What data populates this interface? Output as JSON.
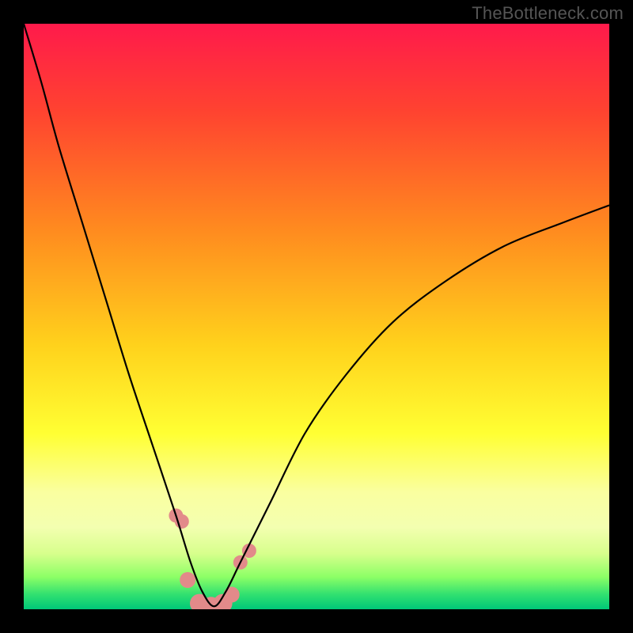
{
  "watermark": "TheBottleneck.com",
  "chart_data": {
    "type": "line",
    "title": "",
    "xlabel": "",
    "ylabel": "",
    "xlim": [
      0,
      100
    ],
    "ylim": [
      0,
      100
    ],
    "grid": false,
    "legend": false,
    "gradient_stops": [
      {
        "offset": 0,
        "color": "#ff1a4b"
      },
      {
        "offset": 0.15,
        "color": "#ff4330"
      },
      {
        "offset": 0.35,
        "color": "#ff8a1f"
      },
      {
        "offset": 0.55,
        "color": "#ffd21c"
      },
      {
        "offset": 0.7,
        "color": "#ffff33"
      },
      {
        "offset": 0.8,
        "color": "#faffa0"
      },
      {
        "offset": 0.86,
        "color": "#f3ffb0"
      },
      {
        "offset": 0.905,
        "color": "#d7ff8c"
      },
      {
        "offset": 0.945,
        "color": "#8cff66"
      },
      {
        "offset": 0.975,
        "color": "#30e070"
      },
      {
        "offset": 1.0,
        "color": "#00c878"
      }
    ],
    "series": [
      {
        "name": "bottleneck-curve",
        "x": [
          0,
          3,
          6,
          10,
          14,
          18,
          22,
          26,
          28.5,
          30.5,
          32.5,
          34.5,
          37,
          42,
          48,
          55,
          63,
          72,
          82,
          92,
          100
        ],
        "values": [
          100,
          90,
          79,
          66,
          53,
          40,
          28,
          16,
          8,
          3,
          0.5,
          3,
          8,
          18,
          30,
          40,
          49,
          56,
          62,
          66,
          69
        ]
      }
    ],
    "markers": {
      "name": "highlighted-points",
      "color": "#e28a8a",
      "x": [
        26.0,
        27.0,
        28.0,
        30.0,
        32.0,
        34.0,
        35.5,
        37.0,
        38.5
      ],
      "values": [
        16.0,
        15.0,
        5.0,
        1.0,
        0.5,
        1.0,
        2.5,
        8.0,
        10.0
      ],
      "radius": [
        9,
        9,
        10,
        12,
        12,
        12,
        10,
        9,
        9
      ]
    }
  }
}
